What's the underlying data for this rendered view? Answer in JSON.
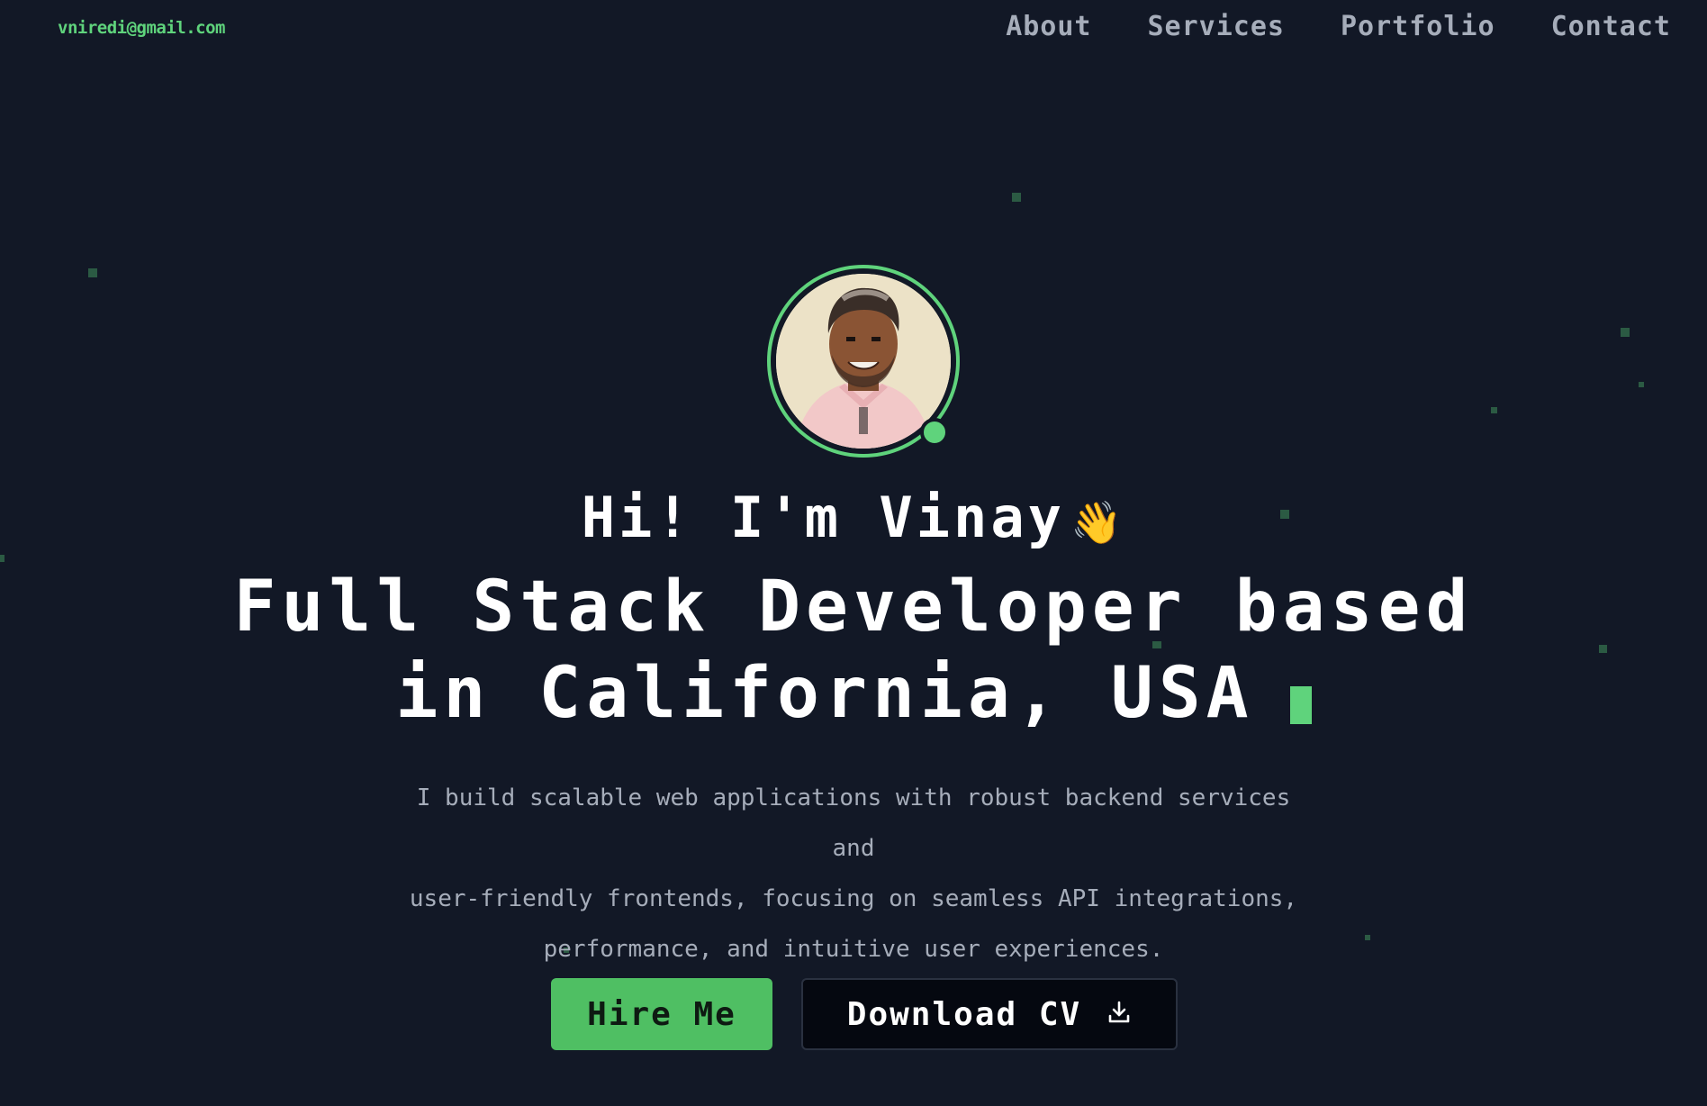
{
  "header": {
    "email": "vniredi@gmail.com",
    "nav": [
      "About",
      "Services",
      "Portfolio",
      "Contact"
    ]
  },
  "hero": {
    "greeting": "Hi! I'm Vinay",
    "wave_emoji": "👋",
    "headline_line1": "Full Stack Developer based",
    "headline_line2": "in California, USA",
    "description_line1": "I build scalable web applications with robust backend services and",
    "description_line2": "user-friendly frontends, focusing on seamless API integrations,",
    "description_line3": "performance, and intuitive user experiences."
  },
  "actions": {
    "hire_label": "Hire Me",
    "cv_label": "Download CV",
    "cv_icon": "download-icon"
  },
  "colors": {
    "background": "#121826",
    "accent": "#5fd37c",
    "text_muted": "#a6adba",
    "button_primary": "#4fbf63",
    "button_dark": "#050810"
  }
}
